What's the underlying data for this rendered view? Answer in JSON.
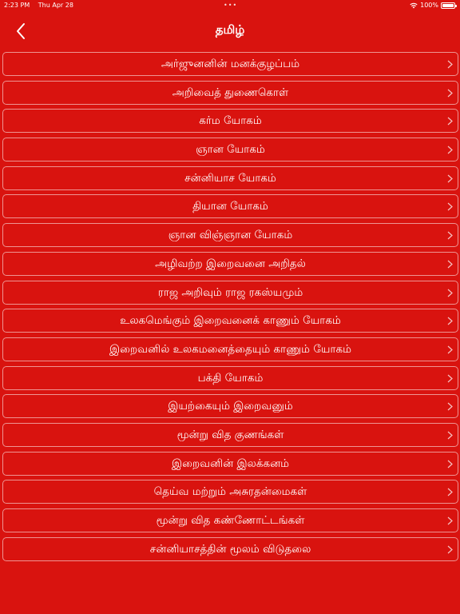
{
  "status_bar": {
    "time": "2:23 PM",
    "date": "Thu Apr 28",
    "multitask_dots": "•••",
    "battery": "100%",
    "icons": [
      "wifi-icon",
      "battery-icon"
    ]
  },
  "nav": {
    "title": "தமிழ்",
    "back_icon": "chevron-left-icon"
  },
  "chapters": [
    {
      "label": "அர்ஜுனனின் மனக்குழப்பம்"
    },
    {
      "label": "அறிவைத் துணைகொள்"
    },
    {
      "label": "கர்ம யோகம்"
    },
    {
      "label": "ஞான யோகம்"
    },
    {
      "label": "சன்னியாச யோகம்"
    },
    {
      "label": "தியான யோகம்"
    },
    {
      "label": "ஞான விஞ்ஞான யோகம்"
    },
    {
      "label": "அழிவற்ற இறைவனை அறிதல்"
    },
    {
      "label": "ராஜ அறிவும் ராஜ ரகஸ்யமும்"
    },
    {
      "label": "உலகமெங்கும் இறைவனைக் காணும் யோகம்"
    },
    {
      "label": "இறைவனில் உலகமனைத்தையும் காணும் யோகம்"
    },
    {
      "label": "பக்தி யோகம்"
    },
    {
      "label": "இயற்கையும் இறைவனும்"
    },
    {
      "label": "மூன்று வித குணங்கள்"
    },
    {
      "label": "இறைவனின் இலக்கனம்"
    },
    {
      "label": "தெய்வ மற்றும் அசுரதன்மைகள்"
    },
    {
      "label": "மூன்று வித கண்ணோட்டங்கள்"
    },
    {
      "label": "சன்னியாசத்தின் மூலம் விடுதலை"
    }
  ],
  "colors": {
    "background": "#d9130f",
    "text": "#ffffff",
    "item_border": "#ffffff"
  }
}
